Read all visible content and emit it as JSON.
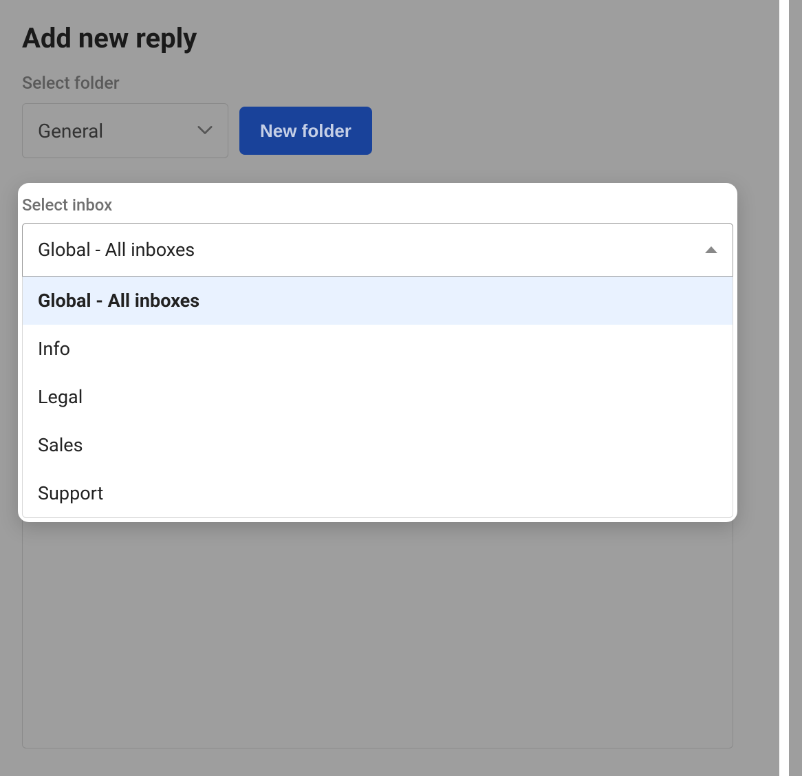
{
  "header": {
    "title": "Add new reply"
  },
  "folder": {
    "label": "Select folder",
    "selected": "General",
    "new_button": "New folder"
  },
  "inbox": {
    "label": "Select inbox",
    "selected": "Global - All inboxes",
    "options": [
      "Global - All inboxes",
      "Info",
      "Legal",
      "Sales",
      "Support"
    ]
  },
  "colors": {
    "primary": "#19429a",
    "overlay_bg": "#9e9e9e",
    "card_bg": "#ffffff",
    "option_selected_bg": "#e9f2ff"
  }
}
